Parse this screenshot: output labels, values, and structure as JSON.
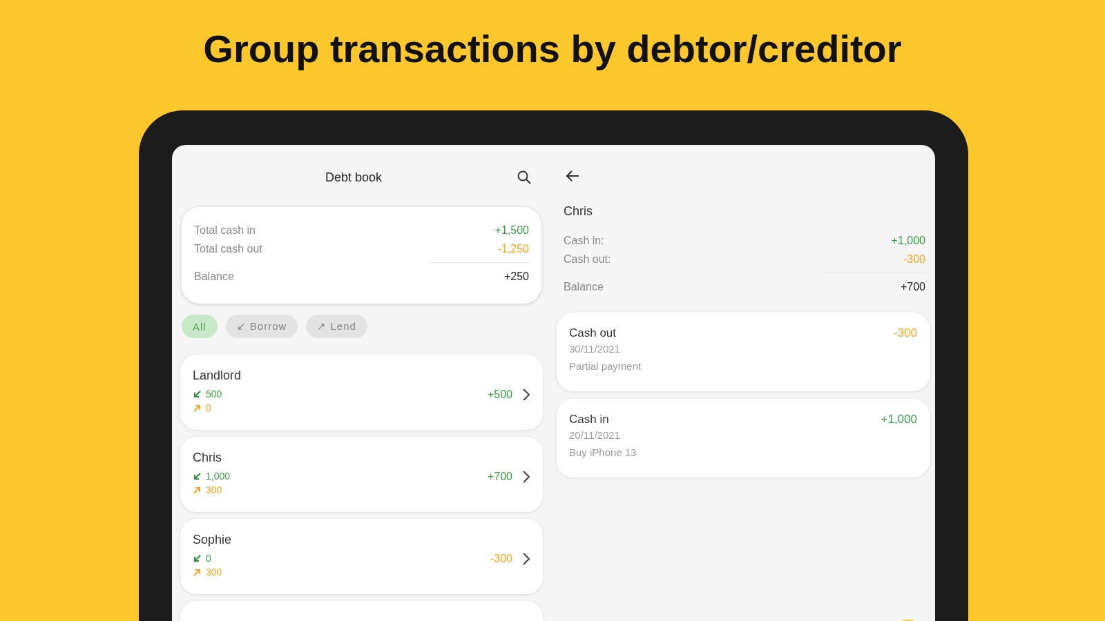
{
  "headline": "Group transactions by debtor/creditor",
  "list_pane": {
    "title": "Debt book",
    "summary": [
      {
        "label": "Total cash in",
        "value": "+1,500",
        "kind": "in"
      },
      {
        "label": "Total cash out",
        "value": "-1,250",
        "kind": "out"
      },
      {
        "label": "Balance",
        "value": "+250",
        "kind": "balance"
      }
    ],
    "filters": [
      {
        "label": "All",
        "selected": true
      },
      {
        "label": "↙ Borrow",
        "selected": false
      },
      {
        "label": "↗ Lend",
        "selected": false
      }
    ],
    "contacts": [
      {
        "name": "Landlord",
        "cash_in": "500",
        "cash_out": "0",
        "balance": "+500",
        "kind": "in"
      },
      {
        "name": "Chris",
        "cash_in": "1,000",
        "cash_out": "300",
        "balance": "+700",
        "kind": "in"
      },
      {
        "name": "Sophie",
        "cash_in": "0",
        "cash_out": "300",
        "balance": "-300",
        "kind": "out"
      }
    ]
  },
  "detail_pane": {
    "title": "Chris",
    "summary": [
      {
        "label": "Cash in:",
        "value": "+1,000",
        "kind": "in"
      },
      {
        "label": "Cash out:",
        "value": "-300",
        "kind": "out"
      },
      {
        "label": "Balance",
        "value": "+700",
        "kind": "balance"
      }
    ],
    "transactions": [
      {
        "type": "Cash out",
        "date": "30/11/2021",
        "note": "Partial payment",
        "amount": "-300",
        "kind": "out"
      },
      {
        "type": "Cash in",
        "date": "20/11/2021",
        "note": "Buy iPhone 13",
        "amount": "+1,000",
        "kind": "in"
      }
    ]
  }
}
